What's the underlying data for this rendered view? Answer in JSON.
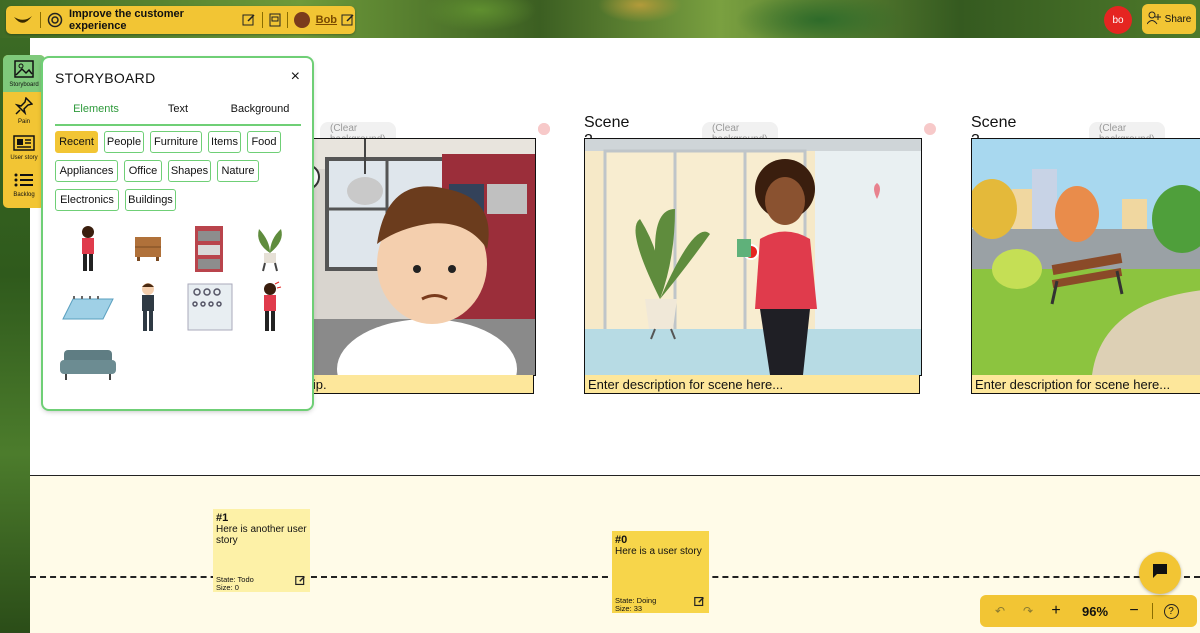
{
  "header": {
    "project_title": "Improve the customer experience",
    "user_name": "Bob",
    "user_initials": "bo",
    "share_label": "Share"
  },
  "leftnav": {
    "items": [
      {
        "label": "Storyboard",
        "icon": "image-icon"
      },
      {
        "label": "Pain",
        "icon": "pin-icon"
      },
      {
        "label": "User story",
        "icon": "card-icon"
      },
      {
        "label": "Backlog",
        "icon": "list-icon"
      }
    ]
  },
  "panel": {
    "title": "STORYBOARD",
    "close_glyph": "×",
    "tabs": [
      "Elements",
      "Text",
      "Background"
    ],
    "categories": [
      "Recent",
      "People",
      "Furniture",
      "Items",
      "Food",
      "Appliances",
      "Office",
      "Shapes",
      "Nature",
      "Electronics",
      "Buildings"
    ]
  },
  "scenes": [
    {
      "title": "",
      "clear_label": "(Clear background)",
      "description": "g to prepare for her trip."
    },
    {
      "title": "Scene 2",
      "clear_label": "(Clear background)",
      "description": "Enter description for scene here..."
    },
    {
      "title": "Scene 3",
      "clear_label": "(Clear background)",
      "description": "Enter description for scene here..."
    }
  ],
  "stories": [
    {
      "number": "#1",
      "text": "Here is another user story",
      "state": "State: Todo",
      "size": "Size:  0"
    },
    {
      "number": "#0",
      "text": "Here is a user story",
      "state": "State: Doing",
      "size": "Size:  33"
    }
  ],
  "zoom": {
    "undo": "↶",
    "redo": "↷",
    "plus": "+",
    "value": "96%",
    "minus": "−",
    "help": "?"
  },
  "colors": {
    "accent_yellow": "#f2c534",
    "accent_green": "#6fcf76",
    "avatar_red": "#e52521",
    "desc_yellow": "#fde79b"
  }
}
